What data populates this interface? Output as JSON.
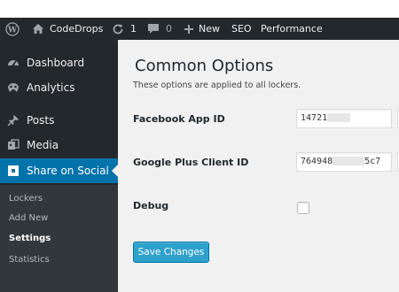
{
  "admin_bar": {
    "wp_logo_icon": "wordpress-logo",
    "site_icon": "home-icon",
    "site_name": "CodeDrops",
    "updates_icon": "refresh-icon",
    "updates_count": "1",
    "comments_icon": "comment-bubble-icon",
    "comments_count": "0",
    "new_icon": "plus-icon",
    "new_label": "New",
    "seo_label": "SEO",
    "performance_label": "Performance"
  },
  "sidebar": {
    "items": [
      {
        "label": "Dashboard",
        "icon": "dashboard-icon"
      },
      {
        "label": "Analytics",
        "icon": "analytics-icon"
      },
      {
        "label": "Posts",
        "icon": "pushpin-icon"
      },
      {
        "label": "Media",
        "icon": "media-icon"
      },
      {
        "label": "Share on Social",
        "icon": "share-box-icon",
        "active": true
      }
    ],
    "submenu": [
      "Lockers",
      "Add New",
      "Settings",
      "Statistics"
    ],
    "submenu_current": "Settings"
  },
  "main": {
    "title": "Common Options",
    "description": "These options are applied to all lockers.",
    "fields": {
      "facebook_label": "Facebook App ID",
      "facebook_value": "14721",
      "google_label": "Google Plus Client ID",
      "google_value_start": "764948",
      "google_value_end": "5c7",
      "debug_label": "Debug",
      "debug_checked": false
    },
    "save_label": "Save Changes"
  },
  "colors": {
    "admin_bar_bg": "#23282d",
    "menu_active": "#0073aa",
    "submenu_bg": "#32373c",
    "content_bg": "#f1f1f1",
    "button_primary": "#2ea2cc"
  }
}
